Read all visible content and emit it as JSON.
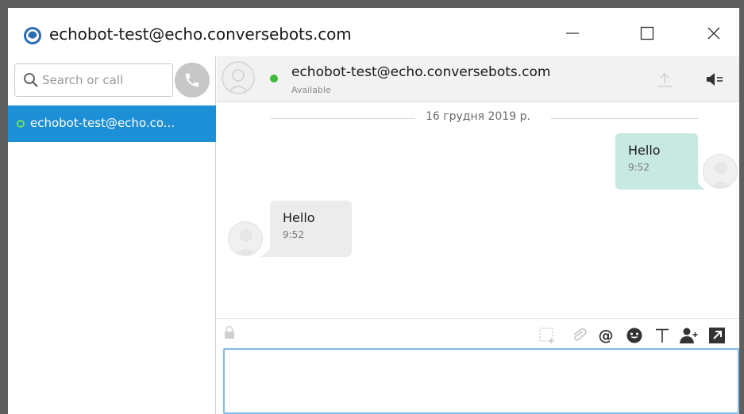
{
  "window": {
    "title": "echobot-test@echo.conversebots.com"
  },
  "sidebar": {
    "search": {
      "placeholder": "Search or call",
      "value": ""
    },
    "contacts": [
      {
        "label": "echobot-test@echo.co...",
        "status": "online",
        "selected": true
      }
    ]
  },
  "chat": {
    "contact_name": "echobot-test@echo.conversebots.com",
    "presence": "Available",
    "date_separator": "16 грудня 2019 р.",
    "messages": [
      {
        "direction": "outgoing",
        "text": "Hello",
        "time": "9:52"
      },
      {
        "direction": "incoming",
        "text": "Hello",
        "time": "9:52"
      }
    ]
  },
  "composer": {
    "value": "",
    "tools": [
      "screenshot-icon",
      "attach-icon",
      "mention-icon",
      "emoji-icon",
      "text-format-icon",
      "add-participant-icon",
      "expand-icon"
    ]
  },
  "colors": {
    "accent": "#1d8fd7",
    "online": "#3dba3a",
    "outgoing_bubble": "#c8e9e2",
    "incoming_bubble": "#ececec"
  }
}
